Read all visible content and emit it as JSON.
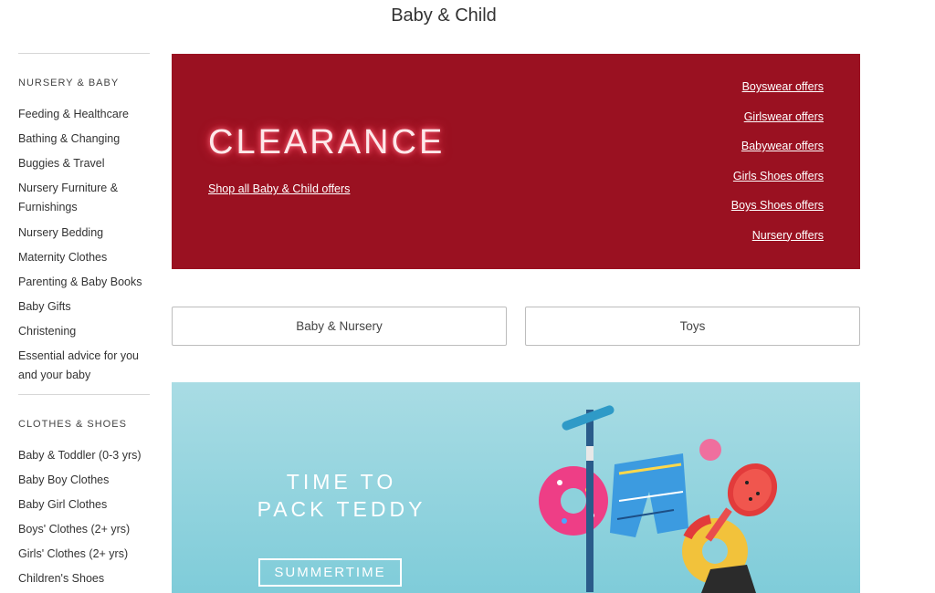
{
  "page": {
    "title": "Baby & Child"
  },
  "sidebar": {
    "sections": [
      {
        "heading": "NURSERY & BABY",
        "items": [
          "Feeding & Healthcare",
          "Bathing & Changing",
          "Buggies & Travel",
          "Nursery Furniture & Furnishings",
          "Nursery Bedding",
          "Maternity Clothes",
          "Parenting & Baby Books",
          "Baby Gifts",
          "Christening",
          "Essential advice for you and your baby"
        ]
      },
      {
        "heading": "CLOTHES & SHOES",
        "items": [
          "Baby & Toddler (0-3 yrs)",
          "Baby Boy Clothes",
          "Baby Girl Clothes",
          "Boys' Clothes (2+ yrs)",
          "Girls' Clothes (2+ yrs)",
          "Children's Shoes"
        ]
      }
    ]
  },
  "clearance": {
    "title": "CLEARANCE",
    "shop_all": "Shop all Baby & Child offers",
    "offers": [
      "Boyswear offers",
      "Girlswear offers",
      "Babywear offers",
      "Girls Shoes offers",
      "Boys Shoes offers",
      "Nursery offers"
    ],
    "background": "#9a1121"
  },
  "categories": {
    "left": "Baby & Nursery",
    "right": "Toys"
  },
  "summer_banner": {
    "line1": "TIME TO",
    "line2": "PACK TEDDY",
    "button": "SUMMERTIME",
    "background": "#8dd1dc"
  }
}
